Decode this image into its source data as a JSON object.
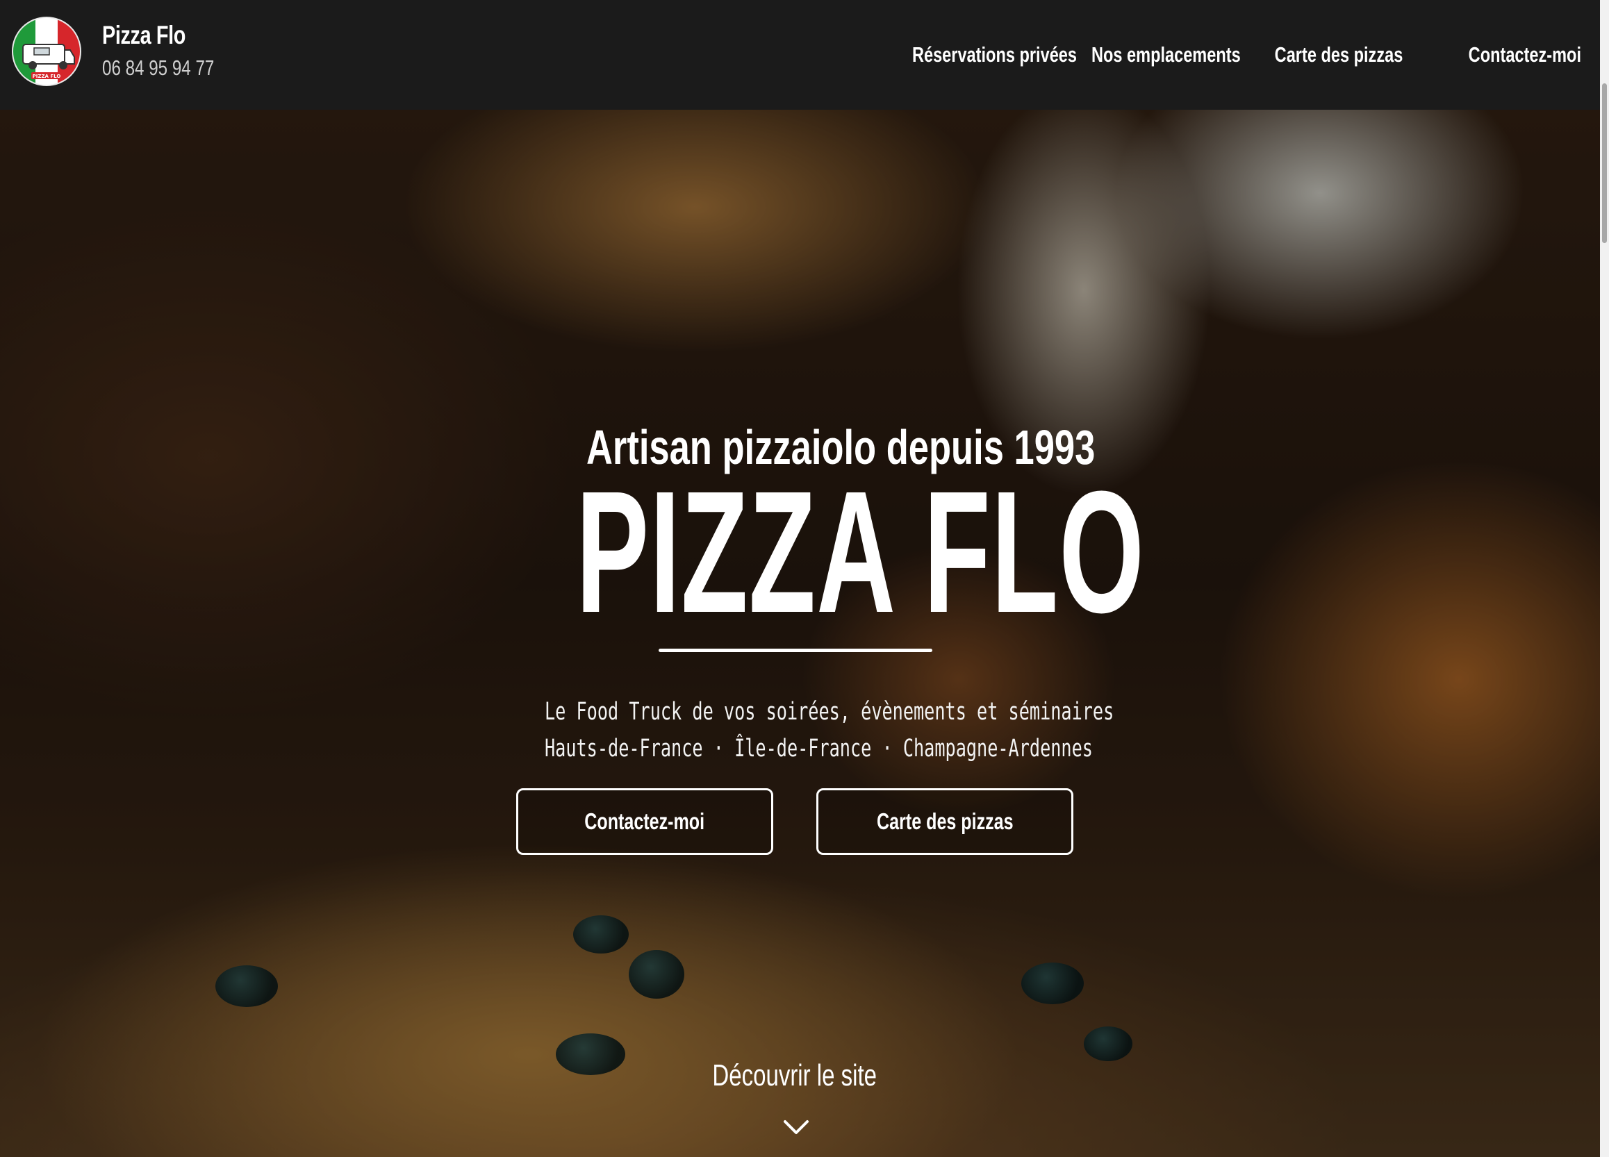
{
  "header": {
    "brand_name": "Pizza Flo",
    "phone": "06 84 95 94 77",
    "logo_caption": "PIZZA FLO"
  },
  "nav": {
    "items": [
      {
        "label": "Réservations privées"
      },
      {
        "label": "Nos emplacements"
      },
      {
        "label": "Carte des pizzas"
      },
      {
        "label": "Contactez-moi"
      }
    ]
  },
  "hero": {
    "tagline": "Artisan pizzaiolo depuis 1993",
    "title": "PIZZA FLO",
    "subtitle_line1": "Le Food Truck de vos soirées, évènements et séminaires",
    "subtitle_line2": "Hauts-de-France  · Île-de-France · Champagne-Ardennes",
    "cta_primary": "Contactez-moi",
    "cta_secondary": "Carte des pizzas",
    "discover_label": "Découvrir le site",
    "discover_icon": "chevron-down-icon"
  },
  "colors": {
    "header_bg": "#1b1b1b",
    "text": "#ffffff",
    "flag_green": "#1f9a3a",
    "flag_red": "#d6262b"
  }
}
